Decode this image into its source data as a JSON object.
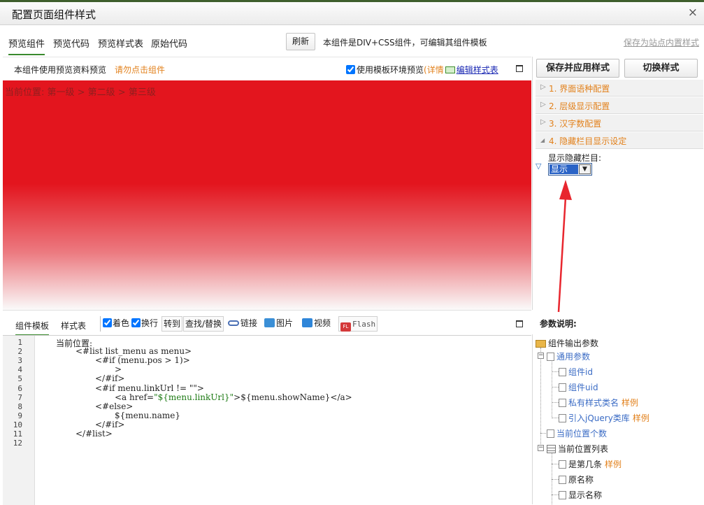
{
  "window": {
    "title": "配置页面组件样式",
    "close_glyph": "×"
  },
  "tabs": [
    "预览组件",
    "预览代码",
    "预览样式表",
    "原始代码"
  ],
  "toolbar": {
    "refresh_label": "刷新",
    "hint": "本组件是DIV+CSS组件，可编辑其组件模板",
    "save_site": "保存为站点内置样式"
  },
  "preview": {
    "label": "本组件使用预览资料预览",
    "warning": "请勿点击组件",
    "use_env_label": "使用模板环境预览",
    "detail_open": "(",
    "detail_label": "详情",
    "edit_css_label": "编辑样式表",
    "breadcrumb": "当前位置: 第一级 > 第二级 > 第三级"
  },
  "right_panel": {
    "save_apply_label": "保存并应用样式",
    "switch_label": "切换样式",
    "sections": [
      {
        "num": "1.",
        "label": "界面语种配置",
        "arrow": "▷"
      },
      {
        "num": "2.",
        "label": "层级显示配置",
        "arrow": "▷"
      },
      {
        "num": "3.",
        "label": "汉字数配置",
        "arrow": "▷"
      },
      {
        "num": "4.",
        "label": "隐藏栏目显示设定",
        "arrow": "◢"
      }
    ],
    "hidden_label": "显示隐藏栏目:",
    "hidden_value": "显示",
    "section_arrow": "▽",
    "dropdown_glyph": "▼"
  },
  "editor_tabs": [
    "组件模板",
    "样式表"
  ],
  "editor_toolbar": {
    "color_label": "着色",
    "wrap_label": "换行",
    "goto_label": "转到",
    "find_label": "查找/替换",
    "link_label": "链接",
    "image_label": "图片",
    "video_label": "视频",
    "flash_label": "Flash",
    "flash_badge": "FL"
  },
  "code_lines": [
    {
      "n": "1",
      "indent": 0,
      "parts": [
        {
          "t": "当前位置:"
        }
      ]
    },
    {
      "n": "2",
      "indent": 1,
      "parts": [
        {
          "t": "<#list list_menu as menu>"
        }
      ]
    },
    {
      "n": "3",
      "indent": 2,
      "parts": [
        {
          "t": "<#if (menu.pos > 1)>"
        }
      ]
    },
    {
      "n": "4",
      "indent": 3,
      "parts": [
        {
          "t": ">"
        }
      ]
    },
    {
      "n": "5",
      "indent": 2,
      "parts": [
        {
          "t": "</#if>"
        }
      ]
    },
    {
      "n": "6",
      "indent": 2,
      "parts": [
        {
          "t": "<#if menu.linkUrl != \"\">"
        }
      ]
    },
    {
      "n": "7",
      "indent": 3,
      "parts": [
        {
          "t": "<a href="
        },
        {
          "t": "\"${menu.linkUrl}\"",
          "s": true
        },
        {
          "t": ">${menu.showName}</a>"
        }
      ]
    },
    {
      "n": "8",
      "indent": 2,
      "parts": [
        {
          "t": "<#else>"
        }
      ]
    },
    {
      "n": "9",
      "indent": 3,
      "parts": [
        {
          "t": "${menu.name}"
        }
      ]
    },
    {
      "n": "10",
      "indent": 2,
      "parts": [
        {
          "t": "</#if>"
        }
      ]
    },
    {
      "n": "11",
      "indent": 1,
      "parts": [
        {
          "t": "</#list>"
        }
      ]
    },
    {
      "n": "12",
      "indent": 0,
      "parts": []
    }
  ],
  "params": {
    "title": "参数说明:",
    "root": "组件输出参数",
    "common": "通用参数",
    "common_items": [
      {
        "label": "组件id",
        "example": ""
      },
      {
        "label": "组件uid",
        "example": ""
      },
      {
        "label": "私有样式类名",
        "example": "样例"
      },
      {
        "label": "引入jQuery类库",
        "example": "样例"
      }
    ],
    "count": "当前位置个数",
    "list": "当前位置列表",
    "list_items": [
      {
        "label": "是第几条",
        "example": "样例"
      },
      {
        "label": "原名称",
        "example": ""
      },
      {
        "label": "显示名称",
        "example": ""
      }
    ],
    "expand_glyph": "−"
  },
  "colors": {
    "accent": "#e2811c",
    "preview_red": "#e3151e",
    "tab_underline": "#3a8a2e",
    "link_blue": "#3b6cc5"
  }
}
